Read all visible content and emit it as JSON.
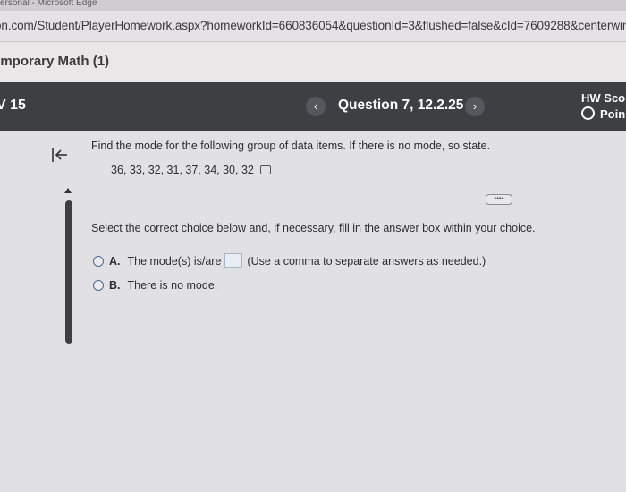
{
  "window": {
    "title": "ersonal - Microsoft Edge"
  },
  "browser": {
    "url": "on.com/Student/PlayerHomework.aspx?homeworkId=660836054&questionId=3&flushed=false&cId=7609288&centerwin=yes"
  },
  "course": {
    "title": "emporary Math (1)"
  },
  "question_bar": {
    "homework": "V 15",
    "prev_icon": "chevron-left-icon",
    "prev_symbol": "‹",
    "question_label": "Question 7, 12.2.25",
    "next_icon": "chevron-right-icon",
    "next_symbol": "›",
    "score_label": "HW Scor",
    "points_label": "Poin"
  },
  "question": {
    "prompt": "Find the mode for the following group of data items. If there is no mode, so state.",
    "data_items": "36, 33, 32, 31, 37, 34, 30, 32",
    "more_button": "••••",
    "instruction": "Select the correct choice below and, if necessary, fill in the answer box within your choice.",
    "choices": [
      {
        "letter": "A.",
        "text_before": "The mode(s) is/are",
        "answer_value": "",
        "text_after": "(Use a comma to separate answers as needed.)"
      },
      {
        "letter": "B.",
        "text": "There is no mode."
      }
    ]
  },
  "colors": {
    "question_bar_bg": "#3d3f43",
    "content_bg": "#e1e0e2",
    "radio_border": "#4a6a9a"
  }
}
